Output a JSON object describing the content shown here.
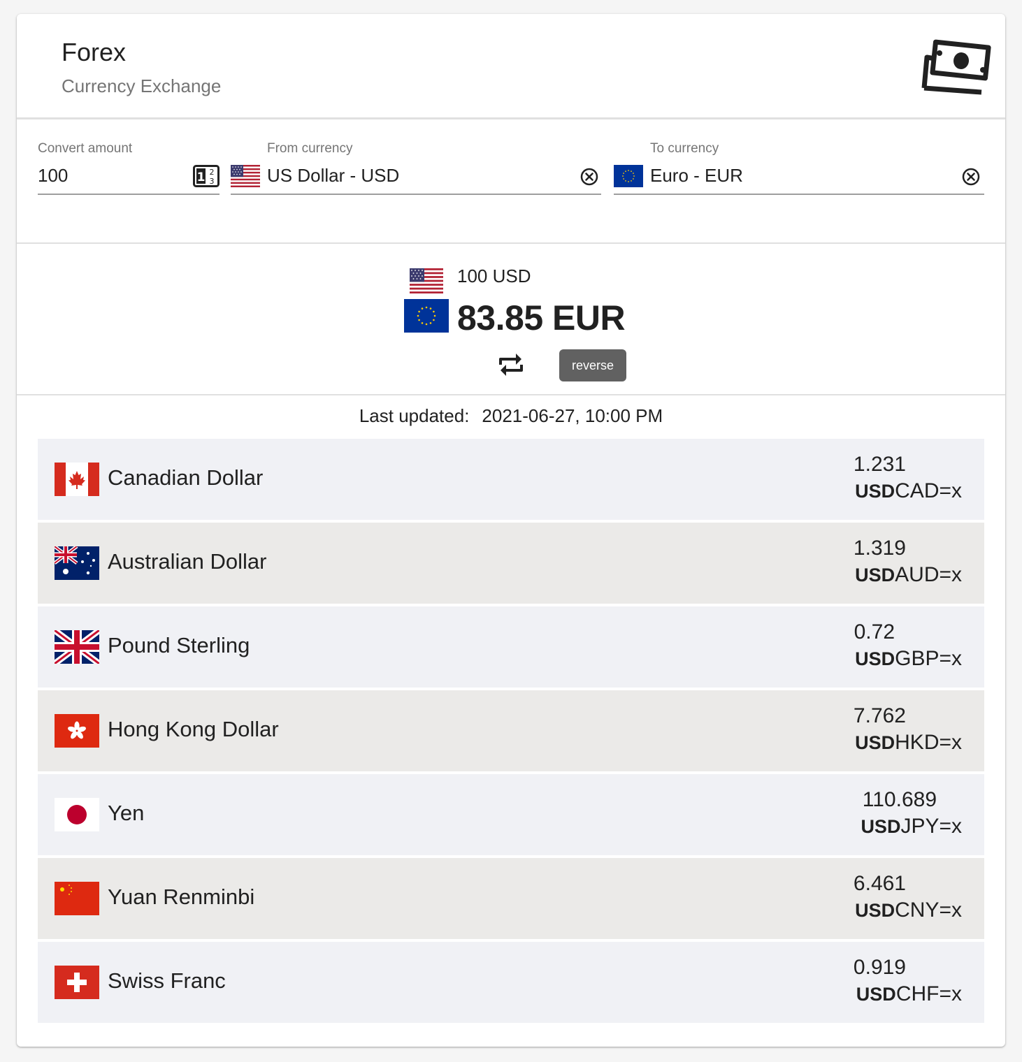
{
  "header": {
    "title": "Forex",
    "subtitle": "Currency Exchange",
    "icon": "money-icon"
  },
  "form": {
    "amount": {
      "label": "Convert amount",
      "value": "100",
      "icon": "calculator-icon"
    },
    "from": {
      "label": "From currency",
      "value": "US Dollar - USD",
      "flag": "us-flag",
      "clear_icon": "clear-icon"
    },
    "to": {
      "label": "To currency",
      "value": "Euro - EUR",
      "flag": "eu-flag",
      "clear_icon": "clear-icon"
    }
  },
  "result": {
    "from_text": "100 USD",
    "to_text": "83.85 EUR",
    "swap_icon": "swap-icon",
    "reverse_label": "reverse"
  },
  "updated": {
    "label": "Last updated:",
    "value": "2021-06-27, 10:00 PM"
  },
  "rates": [
    {
      "name": "Canadian Dollar",
      "value": "1.231",
      "base": "USD",
      "symbol": "CAD=x",
      "flag": "canada-flag"
    },
    {
      "name": "Australian Dollar",
      "value": "1.319",
      "base": "USD",
      "symbol": "AUD=x",
      "flag": "australia-flag"
    },
    {
      "name": "Pound Sterling",
      "value": "0.72",
      "base": "USD",
      "symbol": "GBP=x",
      "flag": "uk-flag"
    },
    {
      "name": "Hong Kong Dollar",
      "value": "7.762",
      "base": "USD",
      "symbol": "HKD=x",
      "flag": "hong-kong-flag"
    },
    {
      "name": "Yen",
      "value": "110.689",
      "base": "USD",
      "symbol": "JPY=x",
      "flag": "japan-flag"
    },
    {
      "name": "Yuan Renminbi",
      "value": "6.461",
      "base": "USD",
      "symbol": "CNY=x",
      "flag": "china-flag"
    },
    {
      "name": "Swiss Franc",
      "value": "0.919",
      "base": "USD",
      "symbol": "CHF=x",
      "flag": "switzerland-flag"
    }
  ],
  "colors": {
    "row_odd": "#f0f1f5",
    "row_even": "#ebeae8",
    "button_bg": "#616161",
    "muted_text": "#757575"
  }
}
